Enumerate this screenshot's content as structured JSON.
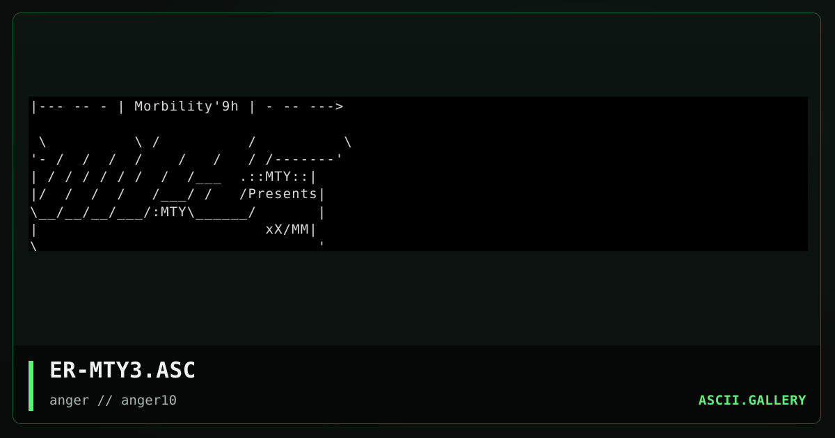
{
  "artwork": {
    "ascii": "|--- -- - | Morbility'9h | - -- --->\n\n \\          \\ /          /          \\\n'- /  /  /  /    /   /   / /-------'\n| / / / / / /  /  /___  .::MTY::|\n|/  /  /  /   /___/ /   /Presents|\n\\__/__/__/___/:MTY\\______/       |\n|                          xX/MM|\n\\                                '"
  },
  "footer": {
    "title": "ER-MTY3.ASC",
    "subtitle": "anger // anger10",
    "brand": "ASCII.GALLERY"
  },
  "colors": {
    "accent": "#5ef07a",
    "background": "#0b1210",
    "card_border": "#2a5a36",
    "art_background": "#000000",
    "art_text": "#d9d9d9"
  }
}
